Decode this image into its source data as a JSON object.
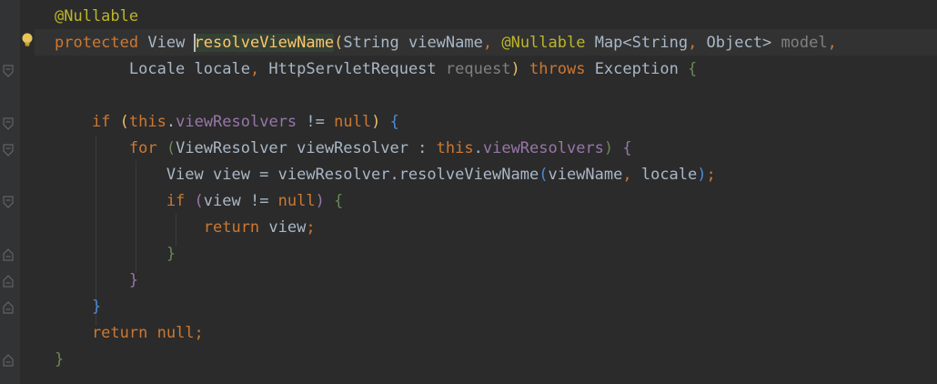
{
  "code": {
    "lines": [
      {
        "parts": [
          {
            "t": "@Nullable",
            "c": "ann"
          }
        ]
      },
      {
        "parts": [
          {
            "t": "protected",
            "c": "kw"
          },
          {
            "t": " View ",
            "c": ""
          },
          {
            "t": "caret",
            "c": "caret"
          },
          {
            "t": "resolveViewName",
            "c": "fn hl-decl"
          },
          {
            "t": "(",
            "c": "b1"
          },
          {
            "t": "String viewName",
            "c": ""
          },
          {
            "t": ", ",
            "c": "kw"
          },
          {
            "t": "@Nullable",
            "c": "ann"
          },
          {
            "t": " Map<String",
            "c": ""
          },
          {
            "t": ", ",
            "c": "kw"
          },
          {
            "t": "Object> ",
            "c": ""
          },
          {
            "t": "model",
            "c": "unused"
          },
          {
            "t": ",",
            "c": "kw"
          }
        ]
      },
      {
        "parts": [
          {
            "t": "        Locale locale",
            "c": ""
          },
          {
            "t": ", ",
            "c": "kw"
          },
          {
            "t": "HttpServletRequest ",
            "c": ""
          },
          {
            "t": "request",
            "c": "unused"
          },
          {
            "t": ")",
            "c": "b1"
          },
          {
            "t": " throws ",
            "c": "kw"
          },
          {
            "t": "Exception ",
            "c": ""
          },
          {
            "t": "{",
            "c": "b3"
          }
        ]
      },
      {
        "parts": []
      },
      {
        "parts": [
          {
            "t": "    if ",
            "c": "kw"
          },
          {
            "t": "(",
            "c": "b1"
          },
          {
            "t": "this",
            "c": "kw"
          },
          {
            "t": ".",
            "c": ""
          },
          {
            "t": "viewResolvers",
            "c": "field"
          },
          {
            "t": " != ",
            "c": ""
          },
          {
            "t": "null",
            "c": "kw"
          },
          {
            "t": ")",
            "c": "b1"
          },
          {
            "t": " ",
            "c": ""
          },
          {
            "t": "{",
            "c": "b4"
          }
        ]
      },
      {
        "parts": [
          {
            "t": "        for ",
            "c": "kw"
          },
          {
            "t": "(",
            "c": "b3"
          },
          {
            "t": "ViewResolver viewResolver : ",
            "c": ""
          },
          {
            "t": "this",
            "c": "kw"
          },
          {
            "t": ".",
            "c": ""
          },
          {
            "t": "viewResolvers",
            "c": "field"
          },
          {
            "t": ")",
            "c": "b3"
          },
          {
            "t": " ",
            "c": ""
          },
          {
            "t": "{",
            "c": "b2"
          }
        ]
      },
      {
        "parts": [
          {
            "t": "            View view = viewResolver.resolveViewName",
            "c": ""
          },
          {
            "t": "(",
            "c": "b4"
          },
          {
            "t": "viewName",
            "c": ""
          },
          {
            "t": ", ",
            "c": "kw"
          },
          {
            "t": "locale",
            "c": ""
          },
          {
            "t": ")",
            "c": "b4"
          },
          {
            "t": ";",
            "c": "kw"
          }
        ]
      },
      {
        "parts": [
          {
            "t": "            if ",
            "c": "kw"
          },
          {
            "t": "(",
            "c": "b2"
          },
          {
            "t": "view != ",
            "c": ""
          },
          {
            "t": "null",
            "c": "kw"
          },
          {
            "t": ")",
            "c": "b2"
          },
          {
            "t": " ",
            "c": ""
          },
          {
            "t": "{",
            "c": "b3"
          }
        ]
      },
      {
        "parts": [
          {
            "t": "                return ",
            "c": "kw"
          },
          {
            "t": "view",
            "c": ""
          },
          {
            "t": ";",
            "c": "kw"
          }
        ]
      },
      {
        "parts": [
          {
            "t": "            }",
            "c": "b3"
          }
        ]
      },
      {
        "parts": [
          {
            "t": "        }",
            "c": "b2"
          }
        ]
      },
      {
        "parts": [
          {
            "t": "    }",
            "c": "b4"
          }
        ]
      },
      {
        "parts": [
          {
            "t": "    return ",
            "c": "kw"
          },
          {
            "t": "null",
            "c": "kw"
          },
          {
            "t": ";",
            "c": "kw"
          }
        ]
      },
      {
        "parts": [
          {
            "t": "}",
            "c": "b3"
          }
        ]
      }
    ]
  },
  "icons": {
    "intention": "lightbulb-icon",
    "fold": "fold-marker-icon"
  },
  "colors": {
    "background": "#2b2b2b",
    "keyword": "#cc7832",
    "annotation": "#bbb529",
    "method": "#ffc66d",
    "field": "#9876aa",
    "unused": "#808080",
    "text": "#a9b7c6"
  }
}
